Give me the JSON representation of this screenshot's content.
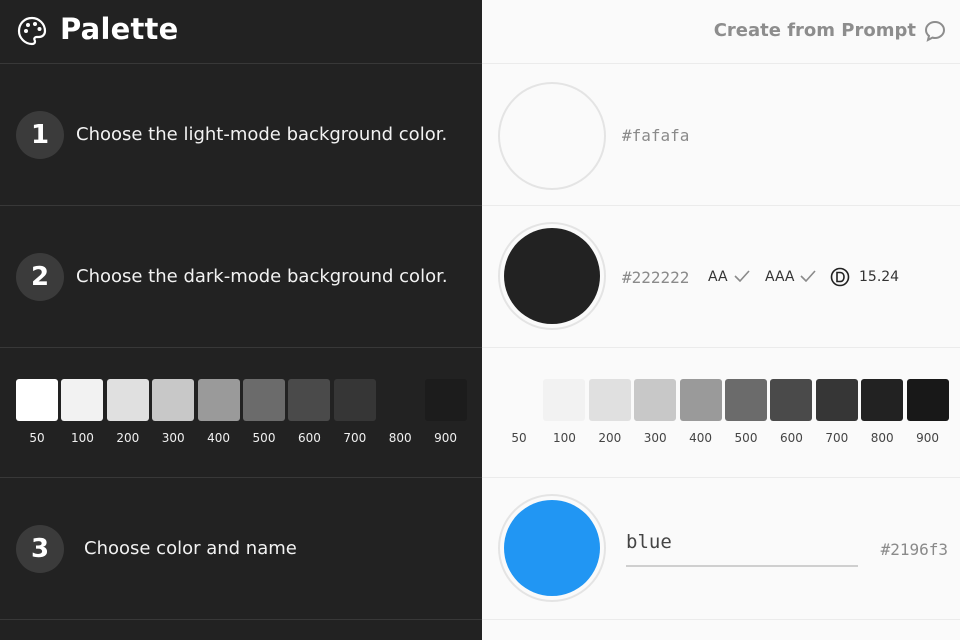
{
  "header": {
    "title": "Palette",
    "create_link": "Create from Prompt"
  },
  "steps": [
    {
      "number": "1",
      "text": "Choose the light-mode background color."
    },
    {
      "number": "2",
      "text": "Choose the dark-mode background color."
    },
    {
      "number": "3",
      "text": "Choose color and name"
    }
  ],
  "light_bg": {
    "hex": "#fafafa",
    "color": "#fafafa"
  },
  "dark_bg": {
    "hex": "#222222",
    "color": "#222222",
    "aa_label": "AA",
    "aaa_label": "AAA",
    "contrast_ratio": "15.24"
  },
  "scale_labels": [
    "50",
    "100",
    "200",
    "300",
    "400",
    "500",
    "600",
    "700",
    "800",
    "900"
  ],
  "dark_scale_colors": [
    "#ffffff",
    "#f2f2f2",
    "#e0e0e0",
    "#c8c8c8",
    "#9a9a9a",
    "#6b6b6b",
    "#4a4a4a",
    "#363636",
    "#222222",
    "#1c1c1c"
  ],
  "light_scale_colors": [
    "#fafafa",
    "#f2f2f2",
    "#e0e0e0",
    "#c8c8c8",
    "#9a9a9a",
    "#6b6b6b",
    "#4a4a4a",
    "#363636",
    "#222222",
    "#181818"
  ],
  "custom_color": {
    "name": "blue",
    "hex": "#2196f3",
    "color": "#2196f3"
  }
}
